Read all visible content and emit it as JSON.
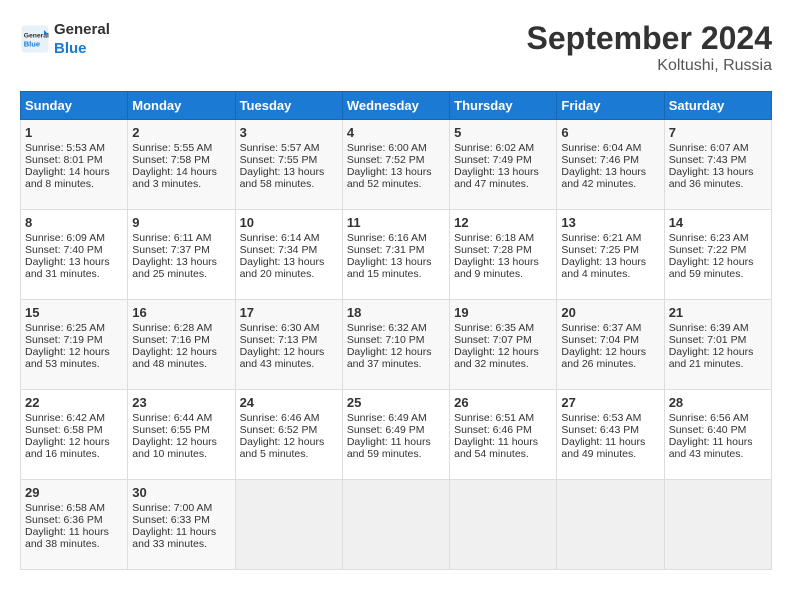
{
  "logo": {
    "line1": "General",
    "line2": "Blue"
  },
  "title": "September 2024",
  "location": "Koltushi, Russia",
  "headers": [
    "Sunday",
    "Monday",
    "Tuesday",
    "Wednesday",
    "Thursday",
    "Friday",
    "Saturday"
  ],
  "weeks": [
    [
      {
        "day": "1",
        "sunrise": "5:53 AM",
        "sunset": "8:01 PM",
        "daylight": "14 hours and 8 minutes."
      },
      {
        "day": "2",
        "sunrise": "5:55 AM",
        "sunset": "7:58 PM",
        "daylight": "14 hours and 3 minutes."
      },
      {
        "day": "3",
        "sunrise": "5:57 AM",
        "sunset": "7:55 PM",
        "daylight": "13 hours and 58 minutes."
      },
      {
        "day": "4",
        "sunrise": "6:00 AM",
        "sunset": "7:52 PM",
        "daylight": "13 hours and 52 minutes."
      },
      {
        "day": "5",
        "sunrise": "6:02 AM",
        "sunset": "7:49 PM",
        "daylight": "13 hours and 47 minutes."
      },
      {
        "day": "6",
        "sunrise": "6:04 AM",
        "sunset": "7:46 PM",
        "daylight": "13 hours and 42 minutes."
      },
      {
        "day": "7",
        "sunrise": "6:07 AM",
        "sunset": "7:43 PM",
        "daylight": "13 hours and 36 minutes."
      }
    ],
    [
      {
        "day": "8",
        "sunrise": "6:09 AM",
        "sunset": "7:40 PM",
        "daylight": "13 hours and 31 minutes."
      },
      {
        "day": "9",
        "sunrise": "6:11 AM",
        "sunset": "7:37 PM",
        "daylight": "13 hours and 25 minutes."
      },
      {
        "day": "10",
        "sunrise": "6:14 AM",
        "sunset": "7:34 PM",
        "daylight": "13 hours and 20 minutes."
      },
      {
        "day": "11",
        "sunrise": "6:16 AM",
        "sunset": "7:31 PM",
        "daylight": "13 hours and 15 minutes."
      },
      {
        "day": "12",
        "sunrise": "6:18 AM",
        "sunset": "7:28 PM",
        "daylight": "13 hours and 9 minutes."
      },
      {
        "day": "13",
        "sunrise": "6:21 AM",
        "sunset": "7:25 PM",
        "daylight": "13 hours and 4 minutes."
      },
      {
        "day": "14",
        "sunrise": "6:23 AM",
        "sunset": "7:22 PM",
        "daylight": "12 hours and 59 minutes."
      }
    ],
    [
      {
        "day": "15",
        "sunrise": "6:25 AM",
        "sunset": "7:19 PM",
        "daylight": "12 hours and 53 minutes."
      },
      {
        "day": "16",
        "sunrise": "6:28 AM",
        "sunset": "7:16 PM",
        "daylight": "12 hours and 48 minutes."
      },
      {
        "day": "17",
        "sunrise": "6:30 AM",
        "sunset": "7:13 PM",
        "daylight": "12 hours and 43 minutes."
      },
      {
        "day": "18",
        "sunrise": "6:32 AM",
        "sunset": "7:10 PM",
        "daylight": "12 hours and 37 minutes."
      },
      {
        "day": "19",
        "sunrise": "6:35 AM",
        "sunset": "7:07 PM",
        "daylight": "12 hours and 32 minutes."
      },
      {
        "day": "20",
        "sunrise": "6:37 AM",
        "sunset": "7:04 PM",
        "daylight": "12 hours and 26 minutes."
      },
      {
        "day": "21",
        "sunrise": "6:39 AM",
        "sunset": "7:01 PM",
        "daylight": "12 hours and 21 minutes."
      }
    ],
    [
      {
        "day": "22",
        "sunrise": "6:42 AM",
        "sunset": "6:58 PM",
        "daylight": "12 hours and 16 minutes."
      },
      {
        "day": "23",
        "sunrise": "6:44 AM",
        "sunset": "6:55 PM",
        "daylight": "12 hours and 10 minutes."
      },
      {
        "day": "24",
        "sunrise": "6:46 AM",
        "sunset": "6:52 PM",
        "daylight": "12 hours and 5 minutes."
      },
      {
        "day": "25",
        "sunrise": "6:49 AM",
        "sunset": "6:49 PM",
        "daylight": "11 hours and 59 minutes."
      },
      {
        "day": "26",
        "sunrise": "6:51 AM",
        "sunset": "6:46 PM",
        "daylight": "11 hours and 54 minutes."
      },
      {
        "day": "27",
        "sunrise": "6:53 AM",
        "sunset": "6:43 PM",
        "daylight": "11 hours and 49 minutes."
      },
      {
        "day": "28",
        "sunrise": "6:56 AM",
        "sunset": "6:40 PM",
        "daylight": "11 hours and 43 minutes."
      }
    ],
    [
      {
        "day": "29",
        "sunrise": "6:58 AM",
        "sunset": "6:36 PM",
        "daylight": "11 hours and 38 minutes."
      },
      {
        "day": "30",
        "sunrise": "7:00 AM",
        "sunset": "6:33 PM",
        "daylight": "11 hours and 33 minutes."
      },
      null,
      null,
      null,
      null,
      null
    ]
  ],
  "labels": {
    "sunrise": "Sunrise: ",
    "sunset": "Sunset: ",
    "daylight": "Daylight: "
  }
}
